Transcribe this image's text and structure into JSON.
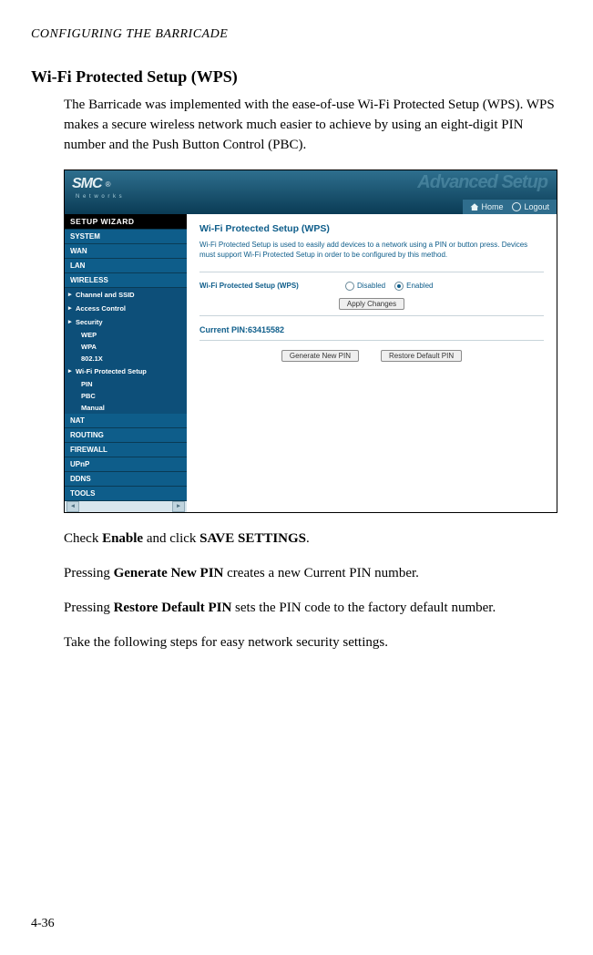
{
  "running_head": "CONFIGURING THE BARRICADE",
  "section_title": "Wi-Fi Protected Setup (WPS)",
  "intro": "The Barricade was implemented with the ease-of-use Wi-Fi Protected Setup (WPS). WPS makes a secure wireless network much easier to achieve by using an eight-digit PIN number and the Push Button Control (PBC).",
  "p_enable_1": "Check ",
  "p_enable_b1": "Enable",
  "p_enable_2": " and click ",
  "p_enable_b2": "SAVE SETTINGS",
  "p_enable_3": ".",
  "p_gen_1": "Pressing ",
  "p_gen_b": "Generate New PIN",
  "p_gen_2": " creates a new Current PIN number.",
  "p_rst_1": "Pressing ",
  "p_rst_b": "Restore Default PIN",
  "p_rst_2": " sets the PIN code to the factory default number.",
  "p_steps": "Take the following steps for easy network security settings.",
  "page_num": "4-36",
  "ss": {
    "logo": "SMC",
    "logo_sub": "N e t w o r k s",
    "header_glow": "Advanced Setup",
    "home_label": "Home",
    "logout_label": "Logout",
    "nav": {
      "setup": "SETUP WIZARD",
      "system": "SYSTEM",
      "wan": "WAN",
      "lan": "LAN",
      "wireless": "WIRELESS",
      "ch_ssid": "Channel and SSID",
      "access": "Access Control",
      "security": "Security",
      "wep": "WEP",
      "wpa": "WPA",
      "dot1x": "802.1X",
      "wps": "Wi-Fi Protected Setup",
      "pin": "PIN",
      "pbc": "PBC",
      "manual": "Manual",
      "nat": "NAT",
      "routing": "ROUTING",
      "firewall": "FIREWALL",
      "upnp": "UPnP",
      "ddns": "DDNS",
      "tools": "TOOLS"
    },
    "panel": {
      "title": "Wi-Fi Protected Setup (WPS)",
      "desc": "Wi-Fi Protected Setup is used to easily add devices to a network using a PIN or button press. Devices must support Wi-Fi Protected Setup in order to be configured by this method.",
      "row_label": "Wi-Fi Protected Setup (WPS)",
      "disabled": "Disabled",
      "enabled": "Enabled",
      "apply": "Apply Changes",
      "pin_line": "Current PIN:63415582",
      "gen": "Generate New PIN",
      "restore": "Restore Default PIN"
    }
  }
}
